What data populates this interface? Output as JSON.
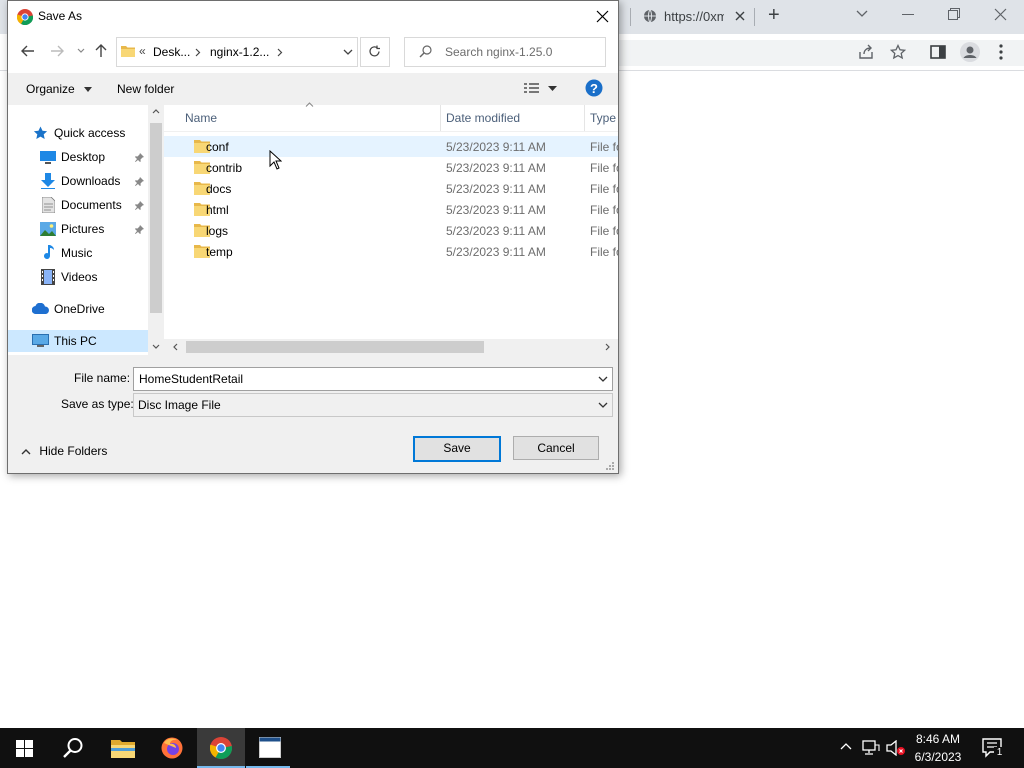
{
  "browser": {
    "tab_title": "https://0xm",
    "new_tab_glyph": "+",
    "window_controls": [
      "chevron-down-icon",
      "minimize-icon",
      "restore-icon",
      "close-icon"
    ]
  },
  "dialog": {
    "title": "Save As",
    "address": {
      "overflow": "«",
      "segments": [
        "Desk...",
        "nginx-1.2..."
      ]
    },
    "search_placeholder": "Search nginx-1.25.0",
    "organize_label": "Organize",
    "new_folder_label": "New folder",
    "help_glyph": "?",
    "nav_pane": {
      "quick_access": "Quick access",
      "items": [
        {
          "label": "Desktop",
          "icon": "desktop-icon",
          "pinned": true
        },
        {
          "label": "Downloads",
          "icon": "downloads-icon",
          "pinned": true
        },
        {
          "label": "Documents",
          "icon": "documents-icon",
          "pinned": true
        },
        {
          "label": "Pictures",
          "icon": "pictures-icon",
          "pinned": true
        },
        {
          "label": "Music",
          "icon": "music-icon",
          "pinned": false
        },
        {
          "label": "Videos",
          "icon": "videos-icon",
          "pinned": false
        }
      ],
      "onedrive": "OneDrive",
      "this_pc": "This PC"
    },
    "columns": {
      "name": "Name",
      "date": "Date modified",
      "type": "Type"
    },
    "files": [
      {
        "name": "conf",
        "date": "5/23/2023 9:11 AM",
        "type": "File folder"
      },
      {
        "name": "contrib",
        "date": "5/23/2023 9:11 AM",
        "type": "File folder"
      },
      {
        "name": "docs",
        "date": "5/23/2023 9:11 AM",
        "type": "File folder"
      },
      {
        "name": "html",
        "date": "5/23/2023 9:11 AM",
        "type": "File folder"
      },
      {
        "name": "logs",
        "date": "5/23/2023 9:11 AM",
        "type": "File folder"
      },
      {
        "name": "temp",
        "date": "5/23/2023 9:11 AM",
        "type": "File folder"
      }
    ],
    "file_name_label": "File name:",
    "file_name_value": "HomeStudentRetail",
    "save_type_label": "Save as type:",
    "save_type_value": "Disc Image File",
    "hide_folders_label": "Hide Folders",
    "save_label": "Save",
    "cancel_label": "Cancel"
  },
  "taskbar": {
    "time": "8:46 AM",
    "date": "6/3/2023",
    "notification_count": "1"
  },
  "colors": {
    "accent": "#0078d7",
    "hover_row": "#e5f3ff",
    "folder": "#f8d775",
    "taskbar": "#101010"
  }
}
